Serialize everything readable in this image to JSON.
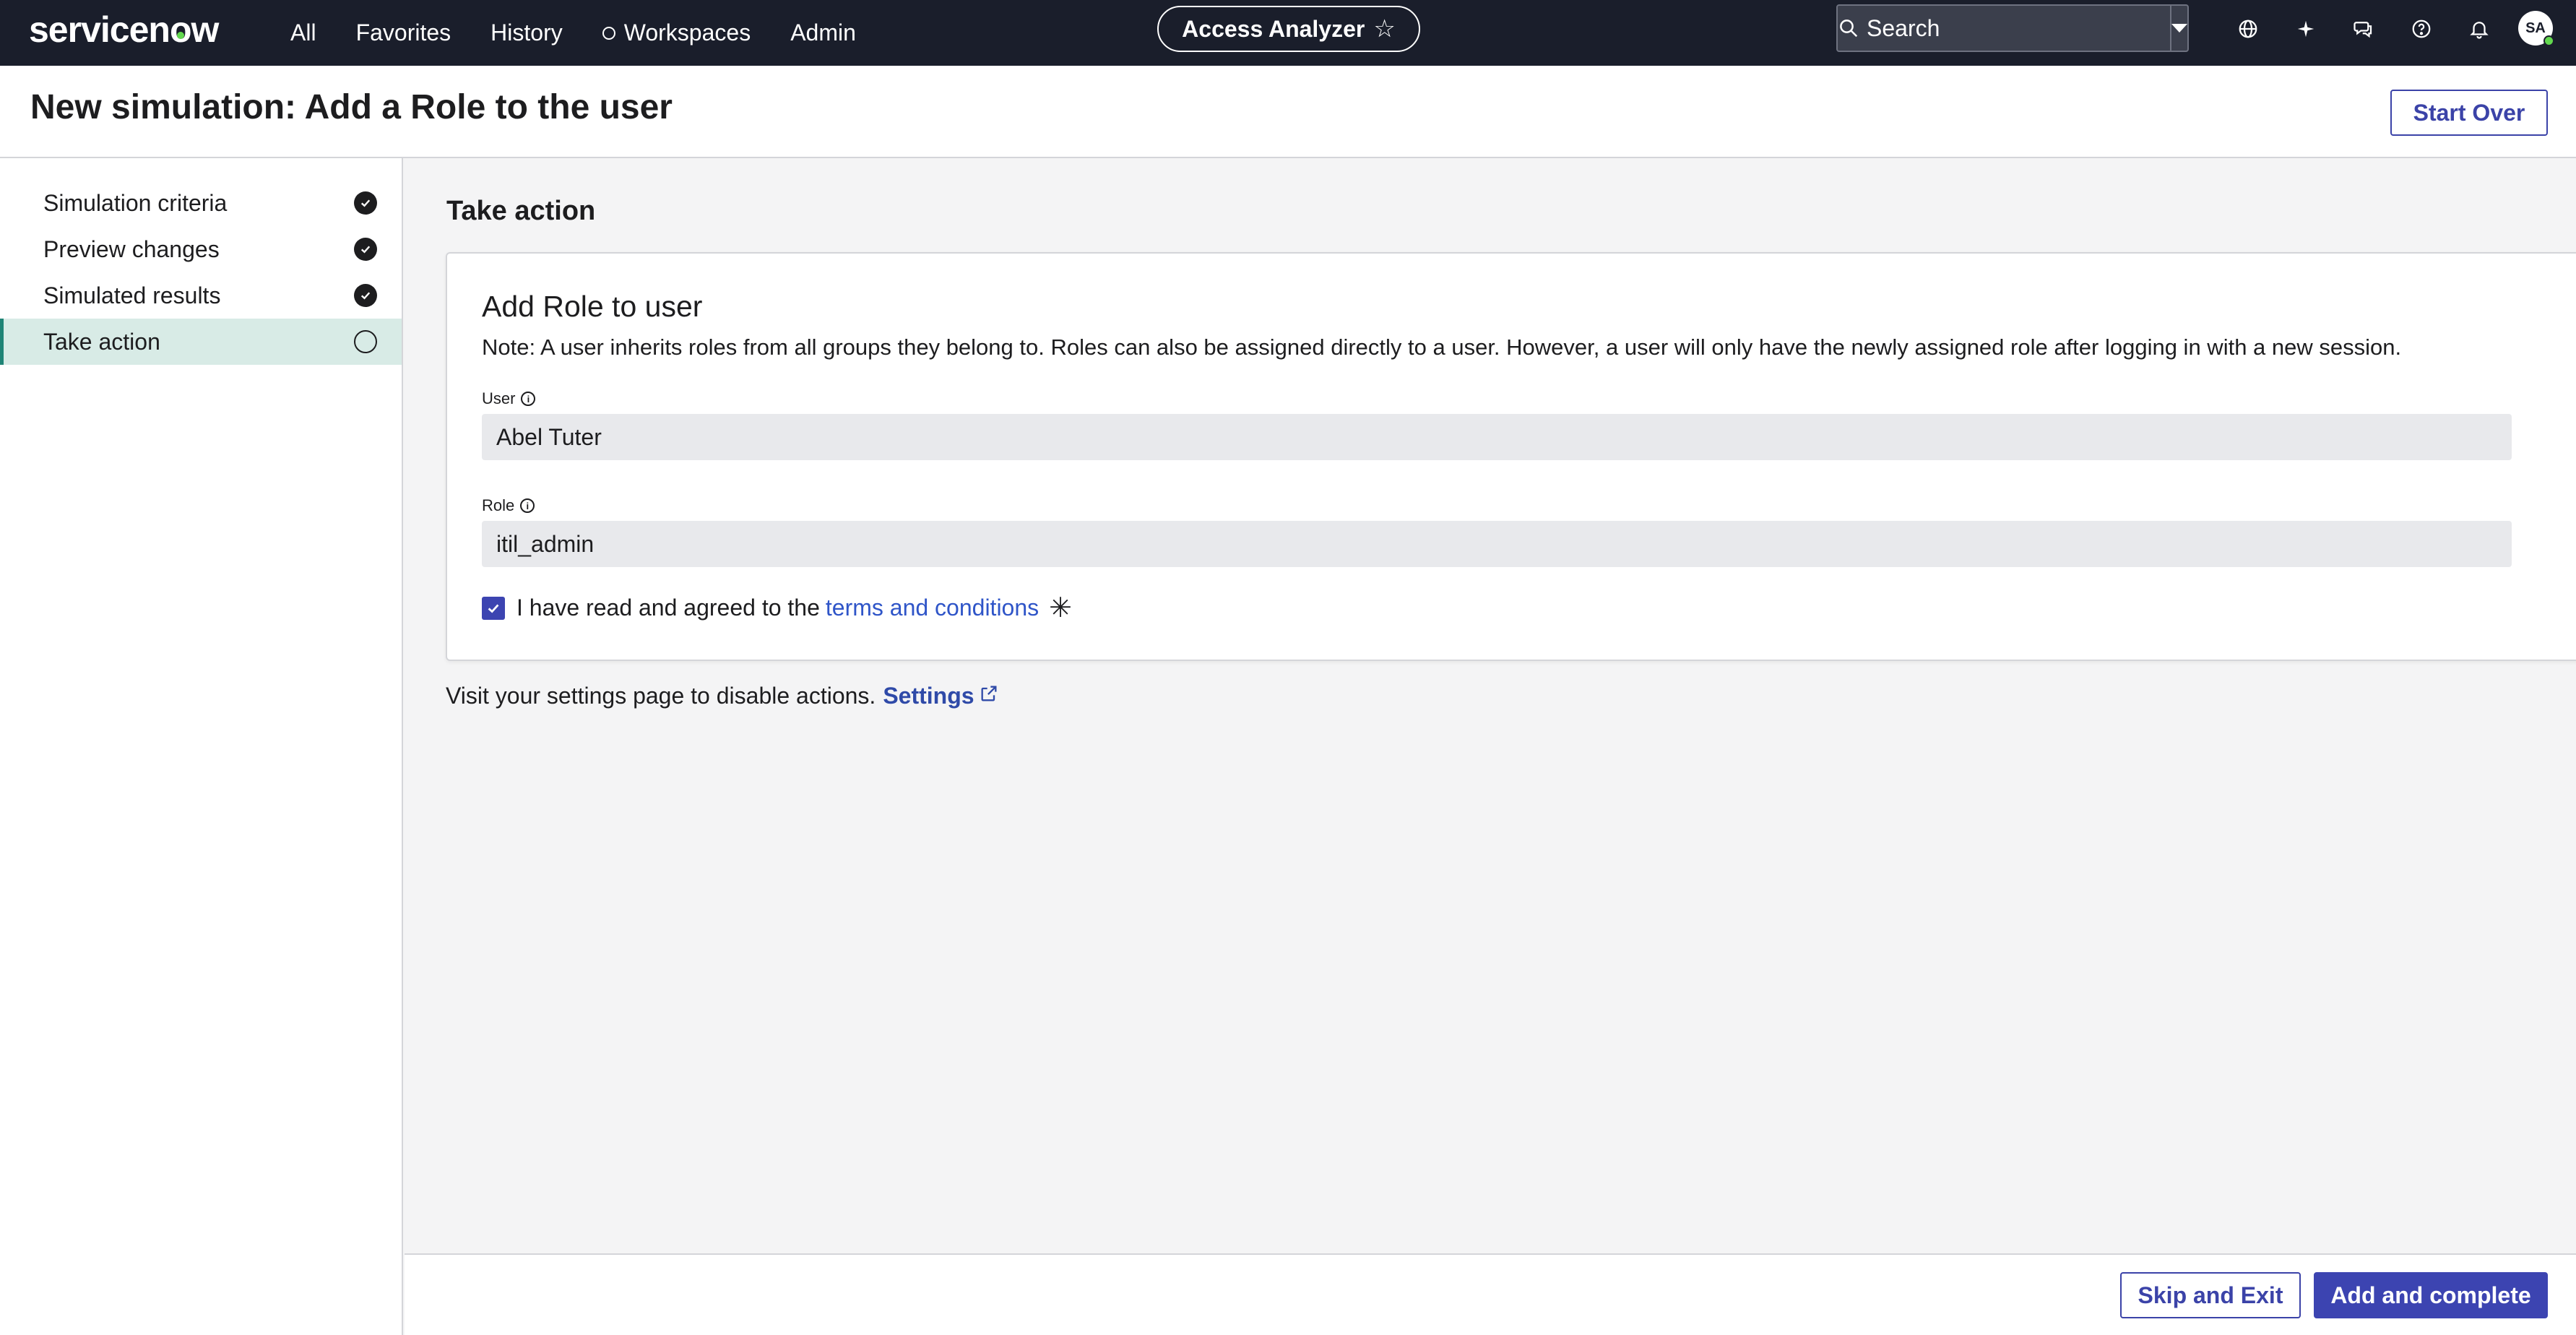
{
  "topnav": {
    "logo": "servicenow",
    "links": [
      "All",
      "Favorites",
      "History",
      "Workspaces",
      "Admin"
    ],
    "app_pill": "Access Analyzer",
    "search_placeholder": "Search",
    "avatar_initials": "SA",
    "icons": [
      "globe-icon",
      "sparkle-icon",
      "chat-icon",
      "help-icon",
      "bell-icon"
    ]
  },
  "header": {
    "title": "New simulation: Add a Role to the user",
    "start_over_label": "Start Over"
  },
  "sidebar": {
    "steps": [
      {
        "label": "Simulation criteria",
        "status": "complete"
      },
      {
        "label": "Preview changes",
        "status": "complete"
      },
      {
        "label": "Simulated results",
        "status": "complete"
      },
      {
        "label": "Take action",
        "status": "current"
      }
    ]
  },
  "main": {
    "section_title": "Take action",
    "card": {
      "title": "Add Role to user",
      "note": "Note: A user inherits roles from all groups they belong to. Roles can also be assigned directly to a user. However, a user will only have the newly assigned role after logging in with a new session.",
      "user_label": "User",
      "user_value": "Abel Tuter",
      "role_label": "Role",
      "role_value": "itil_admin",
      "terms_text": "I have read and agreed to the",
      "terms_link": "terms and conditions",
      "terms_checked": true
    },
    "settings_text": "Visit your settings page to disable actions.",
    "settings_link": "Settings"
  },
  "footer": {
    "skip_label": "Skip and Exit",
    "add_label": "Add and complete"
  },
  "colors": {
    "nav_bg": "#1a1e2b",
    "primary": "#3c44b1",
    "active_step_bg": "#d8ebe6",
    "link": "#2f55c8"
  }
}
